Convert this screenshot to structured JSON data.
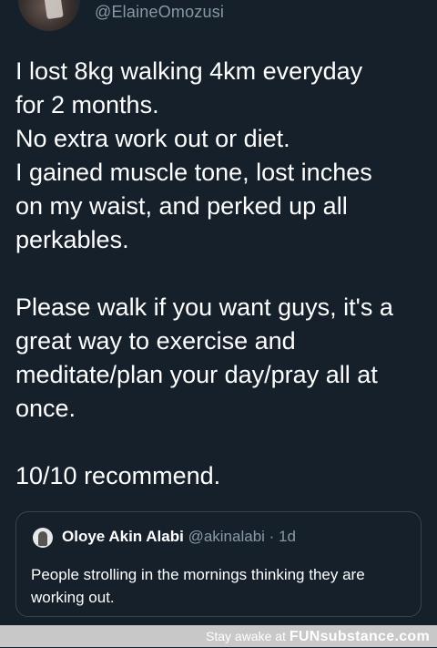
{
  "tweet": {
    "handle": "@ElaineOmozusi",
    "lines": [
      "I lost 8kg walking 4km everyday",
      "for 2 months.",
      "No extra work out or diet.",
      "I gained muscle tone, lost inches",
      "on my waist, and perked up all",
      "perkables.",
      "",
      "Please walk if you want guys, it's a",
      "great way to exercise and",
      "meditate/plan your day/pray all at",
      "once.",
      "",
      "10/10 recommend."
    ]
  },
  "quoted_tweet": {
    "name": "Oloye Akin Alabi",
    "handle": "@akinalabi",
    "separator": " · ",
    "time": "1d",
    "text": "People strolling in the mornings thinking they are working out."
  },
  "watermark": {
    "prefix": "Stay awake at ",
    "brand": "FUNsubstance.com"
  },
  "colors": {
    "background": "#15202b",
    "secondary_text": "#8899a6",
    "border": "#38444d"
  }
}
